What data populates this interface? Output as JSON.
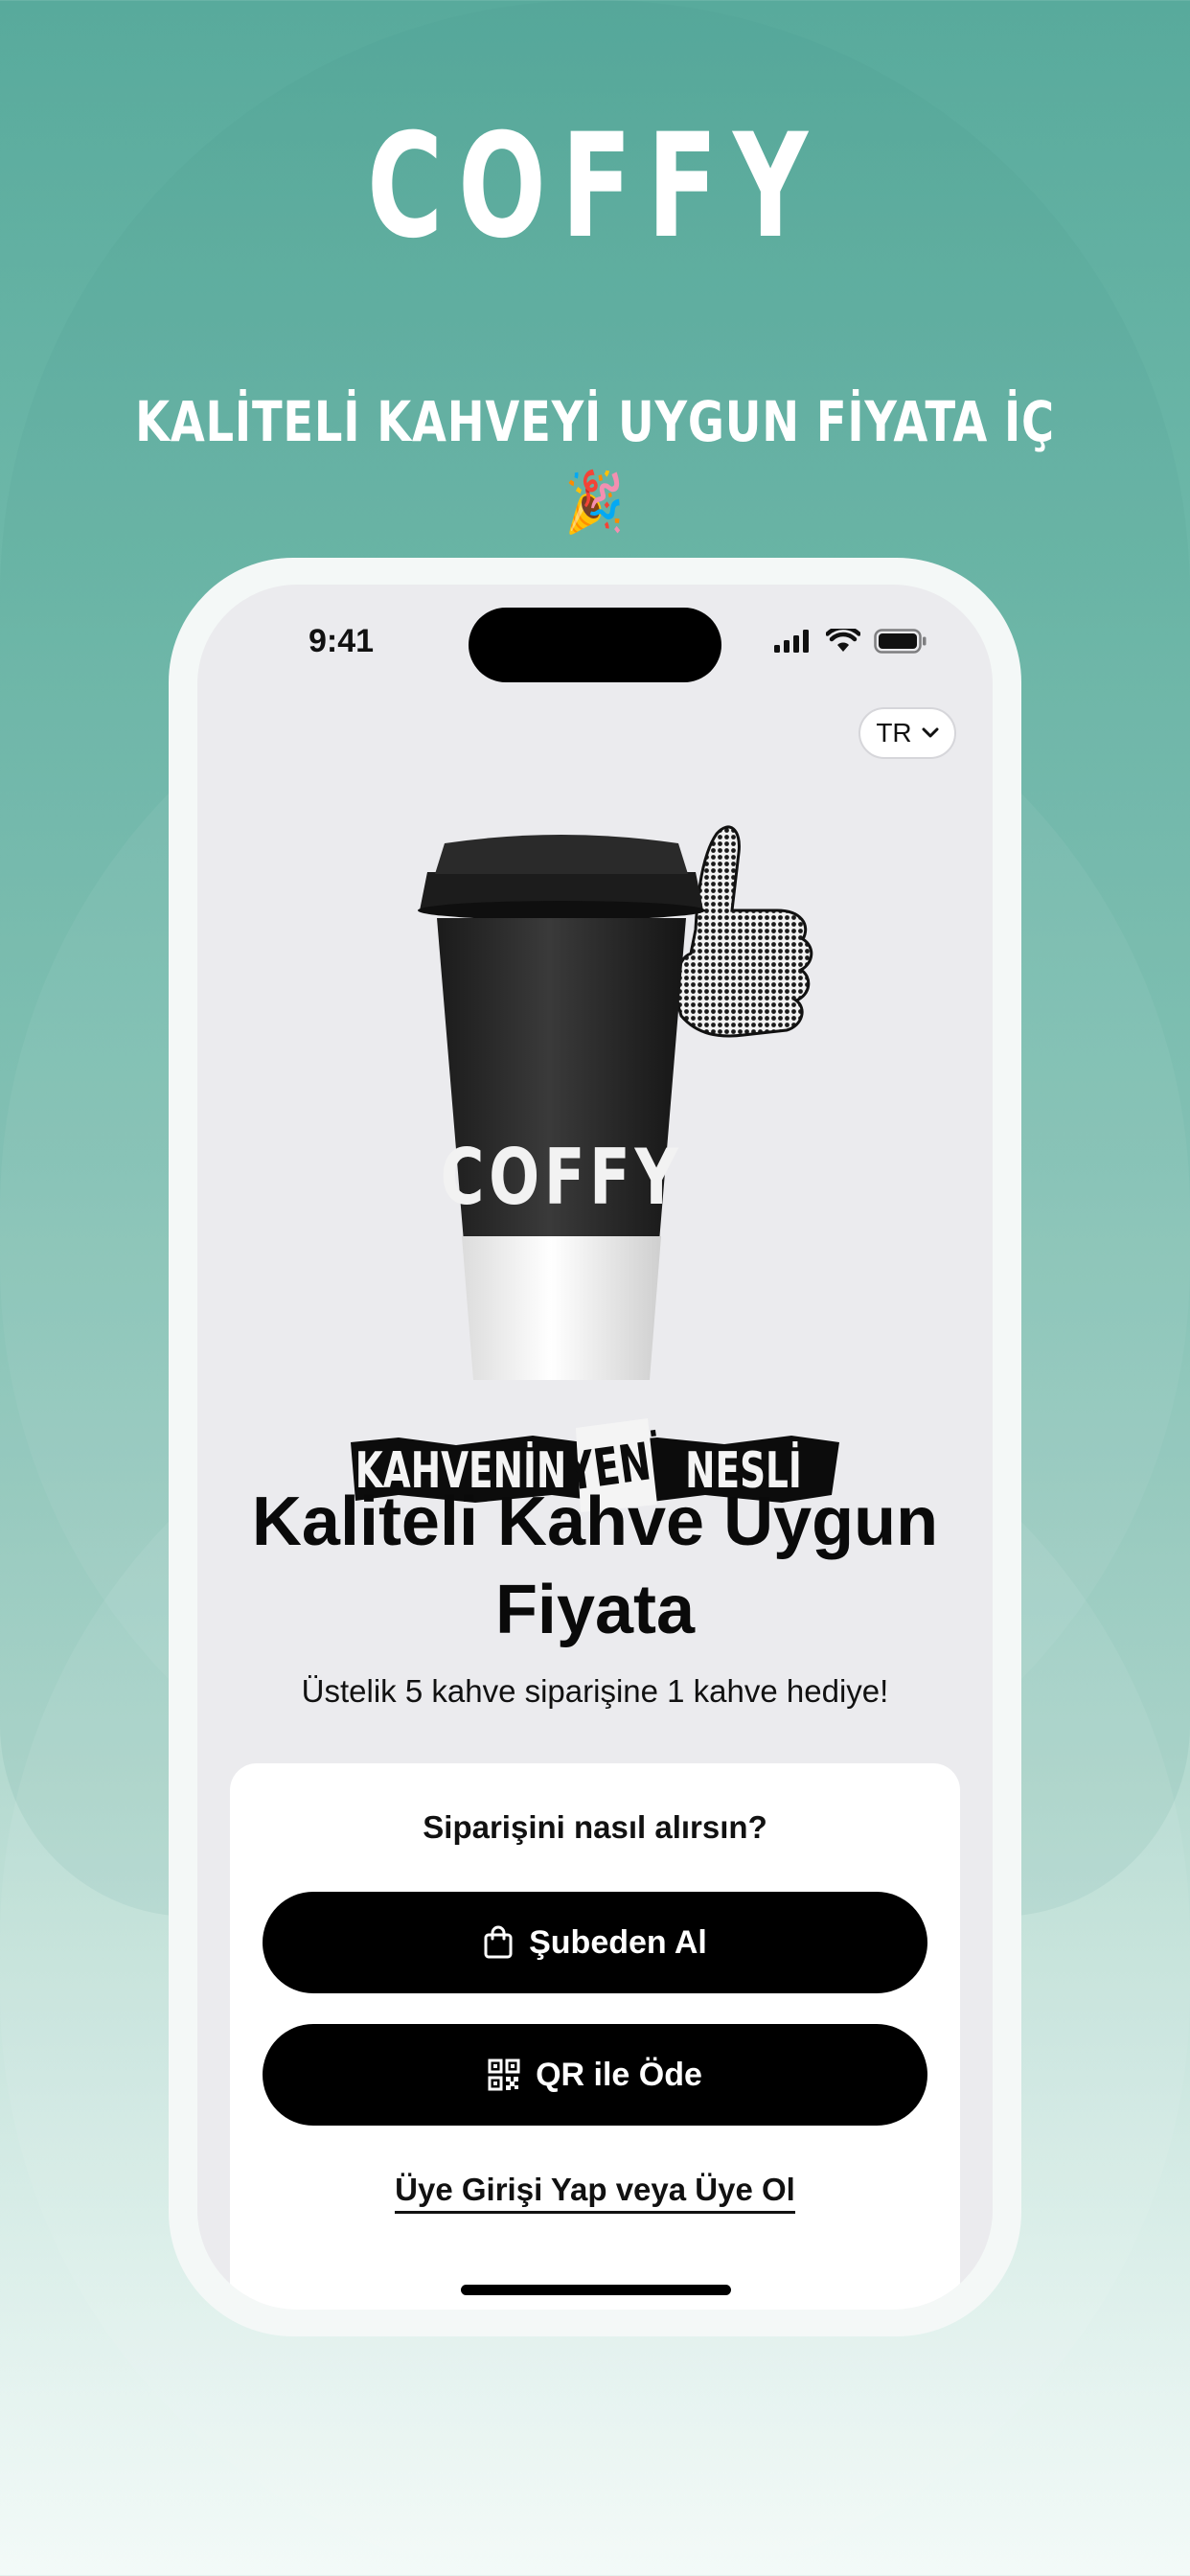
{
  "brand": {
    "name": "COFFY",
    "tagline": "KALİTELİ KAHVEYİ UYGUN FİYATA İÇ",
    "tagline_emoji": "🎉"
  },
  "statusbar": {
    "time": "9:41"
  },
  "language": {
    "selected": "TR"
  },
  "hero": {
    "cup_brand": "COFFY",
    "banner_words": [
      "KAHVENİN",
      "YENİ",
      "NESLİ"
    ]
  },
  "headline": "Kaliteli Kahve Uygun Fiyata",
  "subline": "Üstelik 5 kahve siparişine 1 kahve hediye!",
  "order_card": {
    "title": "Siparişini nasıl alırsın?",
    "pickup_label": "Şubeden Al",
    "qr_label": "QR ile Öde",
    "login_label": "Üye Girişi Yap veya Üye Ol"
  },
  "colors": {
    "accent": "#000000",
    "background_top": "#58aa9c",
    "screen": "#ebebee"
  },
  "icons": [
    "signal-icon",
    "wifi-icon",
    "battery-icon",
    "chevron-down-icon",
    "shopping-bag-icon",
    "qr-code-icon"
  ]
}
